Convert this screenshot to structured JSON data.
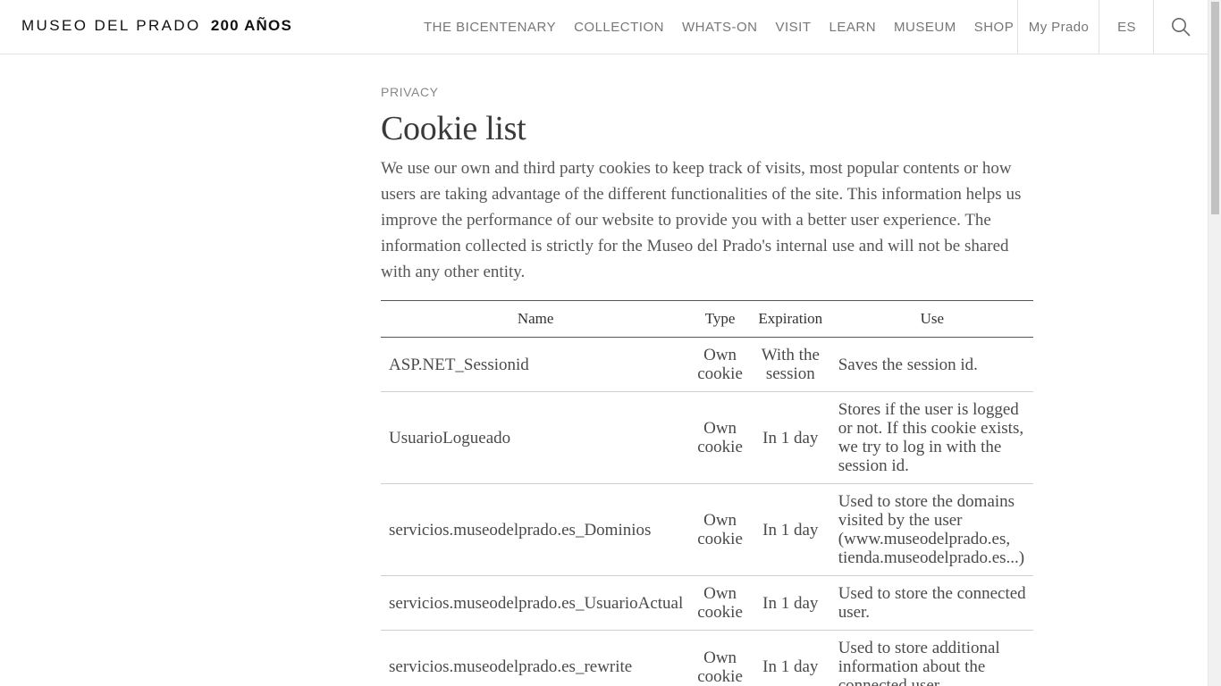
{
  "header": {
    "logo_text": "MUSEO DEL PRADO",
    "logo_bold": "200 AÑOS",
    "nav": [
      "THE BICENTENARY",
      "COLLECTION",
      "WHATS-ON",
      "VISIT",
      "LEARN",
      "MUSEUM",
      "SHOP"
    ],
    "my_prado": "My Prado",
    "language": "ES",
    "search_icon": "search-icon"
  },
  "page": {
    "eyebrow": "PRIVACY",
    "title": "Cookie list",
    "intro": "We use our own and third party cookies to keep track of visits, most popular contents or how users are taking advantage of the different functionalities of the site. This information helps us improve the performance of our website to provide you with a better user experience. The information collected is strictly for the Museo del Prado's internal use and will not be shared with any other entity."
  },
  "table": {
    "headers": [
      "Name",
      "Type",
      "Expiration",
      "Use"
    ],
    "rows": [
      {
        "name": "ASP.NET_Sessionid",
        "type": "Own cookie",
        "expiration": "With the session",
        "use": "Saves the session id."
      },
      {
        "name": "UsuarioLogueado",
        "type": "Own cookie",
        "expiration": "In 1 day",
        "use": "Stores if the user is logged or not. If this cookie exists, we try to log in with the session id."
      },
      {
        "name": "servicios.museodelprado.es_Dominios",
        "type": "Own cookie",
        "expiration": "In 1 day",
        "use": "Used to store the domains visited by the user (www.museodelprado.es, tienda.museodelprado.es...)"
      },
      {
        "name": "servicios.museodelprado.es_UsuarioActual",
        "type": "Own cookie",
        "expiration": "In 1 day",
        "use": "Used to store the connected user."
      },
      {
        "name": "servicios.museodelprado.es_rewrite",
        "type": "Own cookie",
        "expiration": "In 1 day",
        "use": "Used to store additional information about the connected user."
      }
    ]
  }
}
